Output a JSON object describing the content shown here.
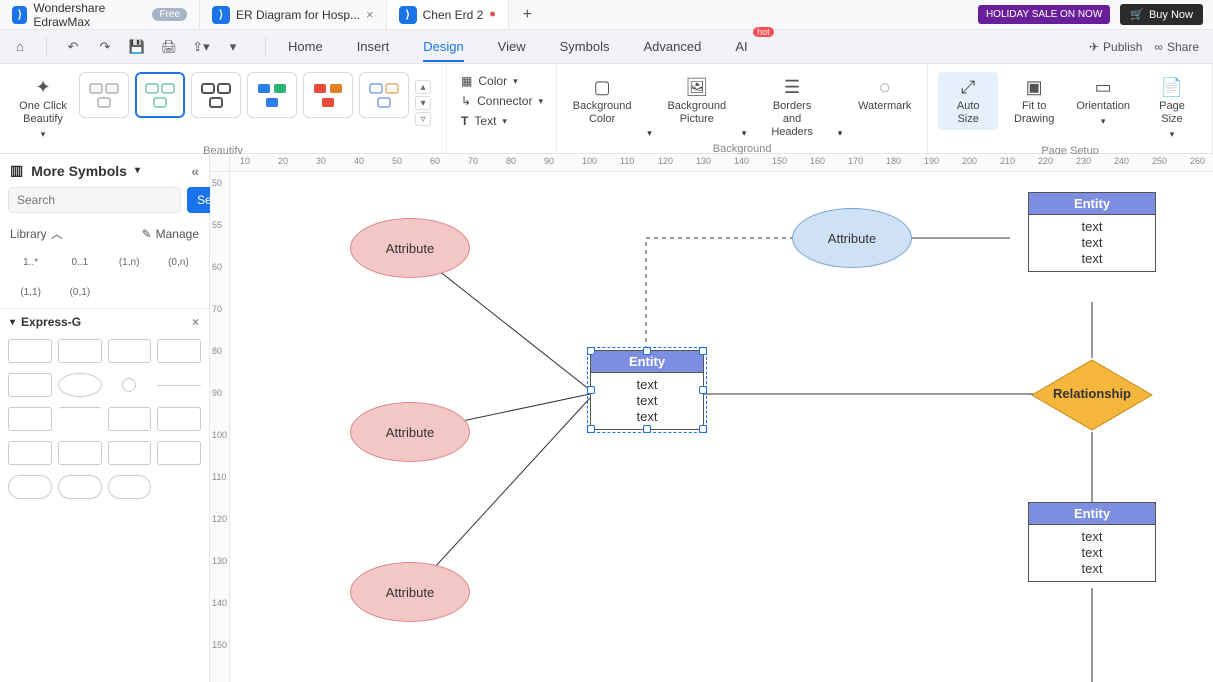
{
  "app": {
    "name": "Wondershare EdrawMax",
    "free_badge": "Free"
  },
  "tabs": [
    {
      "label": "Wondershare EdrawMax"
    },
    {
      "label": "ER Diagram for Hosp..."
    },
    {
      "label": "Chen Erd 2",
      "dirty": true
    }
  ],
  "topright": {
    "holiday": "HOLIDAY SALE ON NOW",
    "buy": "Buy Now"
  },
  "menus": [
    "Home",
    "Insert",
    "Design",
    "View",
    "Symbols",
    "Advanced",
    "AI"
  ],
  "menu_right": {
    "publish": "Publish",
    "share": "Share"
  },
  "ribbon": {
    "beautify": {
      "one_click": "One Click\nBeautify",
      "label": "Beautify"
    },
    "midtools": {
      "color": "Color",
      "connector": "Connector",
      "text": "Text"
    },
    "background": {
      "bg_color": "Background\nColor",
      "bg_pic": "Background\nPicture",
      "borders": "Borders and\nHeaders",
      "watermark": "Watermark",
      "label": "Background"
    },
    "page": {
      "autosize": "Auto\nSize",
      "fit": "Fit to\nDrawing",
      "orientation": "Orientation",
      "pagesize": "Page\nSize",
      "label": "Page Setup"
    }
  },
  "sidebar": {
    "title": "More Symbols",
    "search_ph": "Search",
    "search_btn": "Search",
    "library": "Library",
    "manage": "Manage",
    "card_labels": [
      "1..*",
      "0..1",
      "(1,n)",
      "(0,n)",
      "(1,1)",
      "(0,1)"
    ],
    "section": "Express-G"
  },
  "ruler_h": [
    10,
    20,
    30,
    40,
    50,
    60,
    70,
    80,
    90,
    100,
    110,
    120,
    130,
    140,
    150,
    160,
    170,
    180,
    190,
    200,
    210,
    220,
    230,
    240,
    250,
    260
  ],
  "ruler_v": [
    50,
    55,
    60,
    70,
    80,
    90,
    100,
    110,
    120,
    130,
    140,
    150
  ],
  "shapes": {
    "attr1": "Attribute",
    "attr2": "Attribute",
    "attr3": "Attribute",
    "attr4": "Attribute",
    "entity": "Entity",
    "entity2": "Entity",
    "entity3": "Entity",
    "body": "text\ntext\ntext",
    "relationship": "Relationship"
  }
}
